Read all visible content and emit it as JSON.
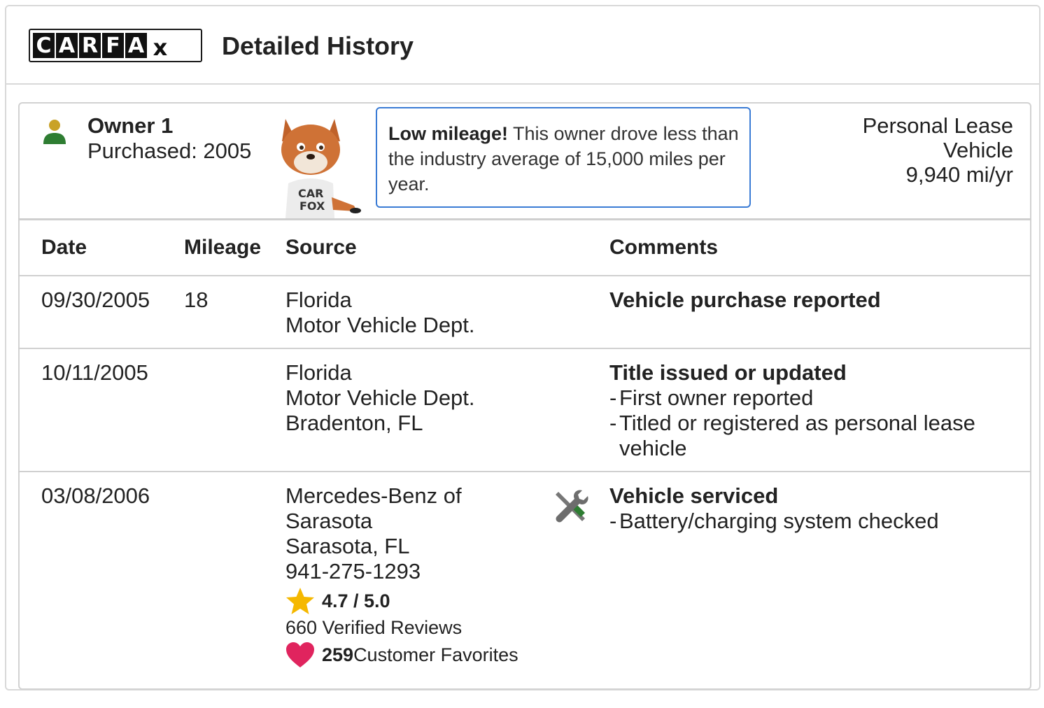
{
  "header": {
    "logo_letters": [
      "C",
      "A",
      "R",
      "F",
      "A",
      "X"
    ],
    "title": "Detailed History"
  },
  "owner": {
    "name": "Owner 1",
    "purchased": "Purchased: 2005",
    "callout_bold": "Low mileage!",
    "callout_text": " This owner drove less than the industry average of 15,000 miles per year.",
    "type_line1": "Personal Lease",
    "type_line2": "Vehicle",
    "mileage_rate": "9,940 mi/yr",
    "mascot_shirt": "CAR FOX"
  },
  "table": {
    "headers": {
      "date": "Date",
      "mileage": "Mileage",
      "source": "Source",
      "comments": "Comments"
    },
    "rows": [
      {
        "date": "09/30/2005",
        "mileage": "18",
        "source": [
          "Florida",
          "Motor Vehicle Dept."
        ],
        "title": "Vehicle purchase reported",
        "details": []
      },
      {
        "date": "10/11/2005",
        "mileage": "",
        "source": [
          "Florida",
          "Motor Vehicle Dept.",
          "Bradenton, FL"
        ],
        "title": "Title issued or updated",
        "details": [
          "First owner reported",
          "Titled or registered as personal lease",
          "vehicle"
        ]
      },
      {
        "date": "03/08/2006",
        "mileage": "",
        "source": [
          "Mercedes-Benz of",
          "Sarasota",
          "Sarasota, FL",
          "941-275-1293"
        ],
        "rating": "4.7 / 5.0",
        "reviews": "660 Verified Reviews",
        "favorites_count": "259",
        "favorites_label": " Customer Favorites",
        "title": "Vehicle serviced",
        "details": [
          "Battery/charging system checked"
        ],
        "service_icon": "wrench-screwdriver-icon"
      }
    ]
  },
  "colors": {
    "callout_border": "#3a7bd5",
    "owner_icon_head": "#c9a227",
    "owner_icon_body": "#2e7d32",
    "star": "#f5b800",
    "heart": "#e0245e"
  }
}
